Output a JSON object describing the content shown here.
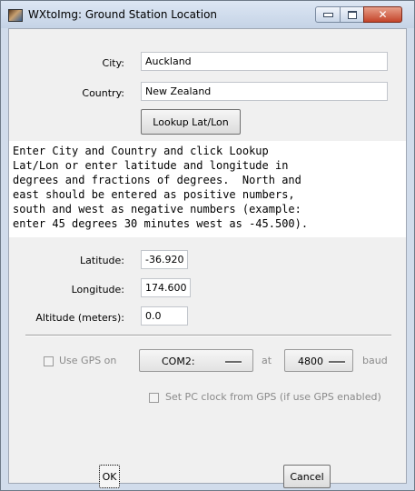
{
  "window": {
    "title": "WXtoImg: Ground Station Location",
    "close_glyph": "✕"
  },
  "form": {
    "city_label": "City:",
    "city_value": "Auckland",
    "country_label": "Country:",
    "country_value": "New Zealand",
    "lookup_label": "Lookup Lat/Lon",
    "info_text": "Enter City and Country and click Lookup\nLat/Lon or enter latitude and longitude in\ndegrees and fractions of degrees.  North and\neast should be entered as positive numbers,\nsouth and west as negative numbers (example:\nenter 45 degrees 30 minutes west as -45.500).",
    "latitude_label": "Latitude:",
    "latitude_value": "-36.920",
    "longitude_label": "Longitude:",
    "longitude_value": "174.600",
    "altitude_label": "Altitude (meters):",
    "altitude_value": "0.0"
  },
  "gps": {
    "use_gps_label": "Use GPS on",
    "use_gps_checked": false,
    "port_value": "COM2:",
    "at_label": "at",
    "baud_value": "4800",
    "baud_label": "baud",
    "set_clock_label": "Set PC clock from GPS (if use GPS enabled)",
    "set_clock_checked": false
  },
  "actions": {
    "ok_label": "OK",
    "cancel_label": "Cancel"
  },
  "icons": [
    "app-icon",
    "minimize-icon",
    "maximize-icon",
    "close-icon",
    "dropdown-arrow-icon"
  ]
}
